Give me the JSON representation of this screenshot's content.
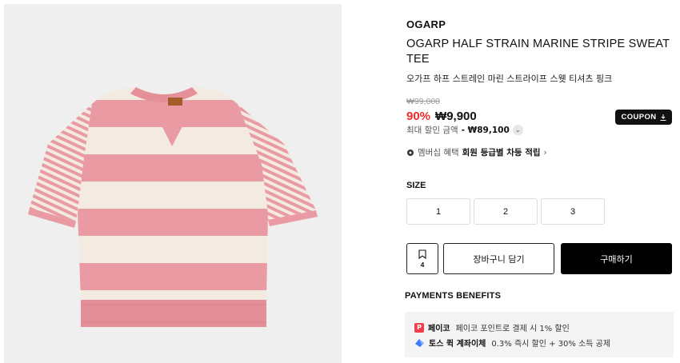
{
  "product": {
    "brand": "OGARP",
    "title": "OGARP HALF STRAIN MARINE STRIPE SWEAT TEE",
    "subtitle_kr": "오가프 하프 스트레인 마린 스트라이프 스웻 티셔츠 핑크",
    "original_price": "₩99,000",
    "discount_rate": "90%",
    "sale_price": "₩9,900",
    "coupon_label": "COUPON",
    "max_discount_label": "최대 할인 금액",
    "max_discount_value": "- ₩89,100",
    "membership_label": "멤버십 혜택",
    "membership_link": "회원 등급별 차등 적립"
  },
  "size": {
    "label": "SIZE",
    "options": [
      "1",
      "2",
      "3"
    ]
  },
  "actions": {
    "wishlist_count": "4",
    "cart_label": "장바구니 담기",
    "buy_label": "구매하기"
  },
  "payments": {
    "label": "PAYMENTS BENEFITS",
    "items": [
      {
        "name": "페이코",
        "desc": "페이코 포인트로 결제 시 1% 할인",
        "icon": "payco-icon"
      },
      {
        "name": "토스 퀵 계좌이체",
        "desc": "0.3% 즉시 할인 + 30% 소득 공제",
        "icon": "toss-icon"
      }
    ]
  },
  "colors": {
    "discount": "#ef2a2a",
    "stripe_pink": "#e99aa2",
    "stripe_cream": "#f3ebe1",
    "primary_button": "#000000"
  }
}
